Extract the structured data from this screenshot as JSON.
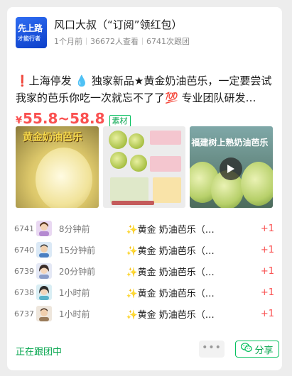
{
  "header": {
    "avatar_text_1": "先上路",
    "avatar_text_2": "才能行者",
    "title": "风口大叔（“订阅”领红包）",
    "posted": "1个月前",
    "views": "36672人查看",
    "joins": "6741次跟团"
  },
  "post": {
    "description": "❗上海停发 💧 独家新品★黄金奶油芭乐，一定要尝试 我家的芭乐你吃一次就忘不了了💯 专业团队研发…",
    "price_symbol": "¥",
    "price": "55.8~58.8",
    "tag": "素材",
    "image1_caption": "黄金奶油芭乐",
    "image3_caption": "福建树上熟奶油芭乐"
  },
  "orders": [
    {
      "no": "6741",
      "time": "8分钟前",
      "item": "✨黄金 奶油芭乐（…",
      "qty": "+1"
    },
    {
      "no": "6740",
      "time": "15分钟前",
      "item": "✨黄金 奶油芭乐（…",
      "qty": "+1"
    },
    {
      "no": "6739",
      "time": "20分钟前",
      "item": "✨黄金 奶油芭乐（…",
      "qty": "+1"
    },
    {
      "no": "6738",
      "time": "1小时前",
      "item": "✨黄金 奶油芭乐（…",
      "qty": "+1"
    },
    {
      "no": "6737",
      "time": "1小时前",
      "item": "✨黄金 奶油芭乐（…",
      "qty": "+1"
    }
  ],
  "footer": {
    "status": "正在跟团中",
    "more": "•••",
    "share": "分享"
  },
  "colors": {
    "price_red": "#fa5151",
    "wechat_green": "#07c160"
  }
}
